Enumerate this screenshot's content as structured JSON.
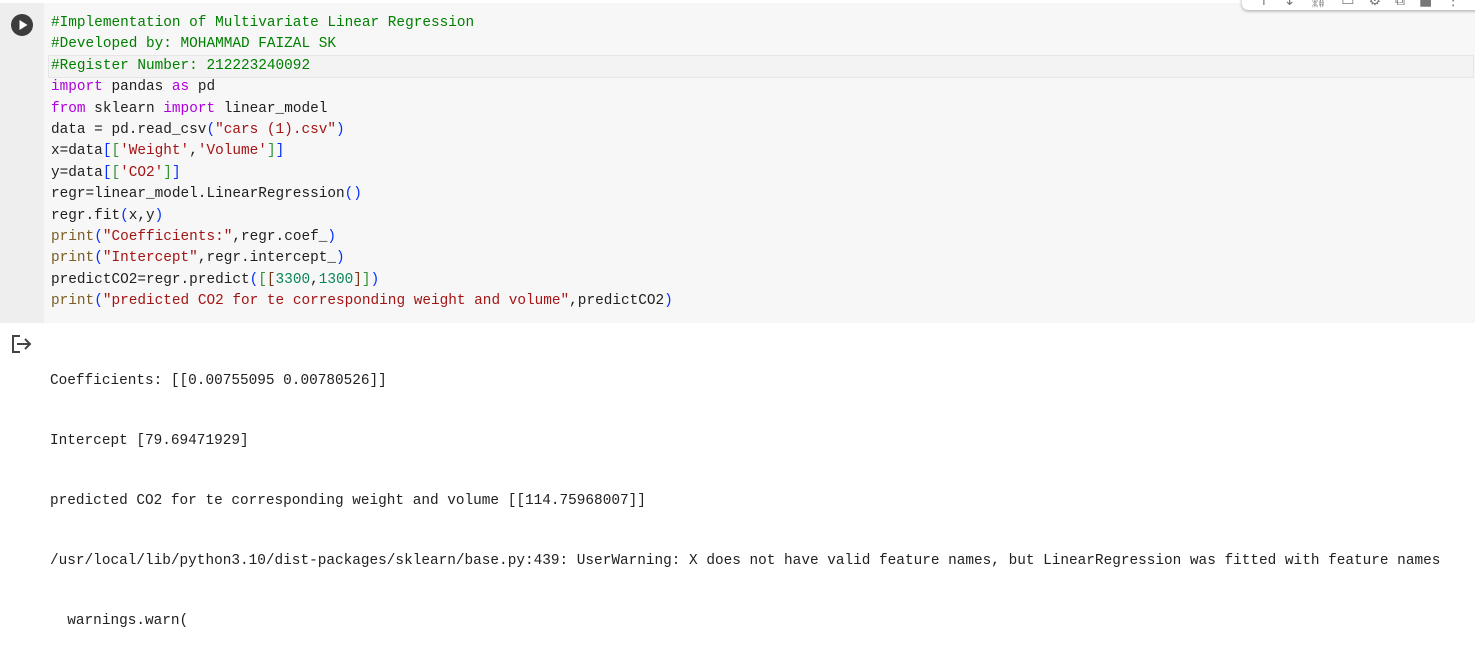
{
  "cell": {
    "run_icon": "play-circle-icon",
    "code_lines": [
      [
        [
          "#Implementation of Multivariate Linear Regression",
          "comment"
        ]
      ],
      [
        [
          "#Developed by: MOHAMMAD FAIZAL SK",
          "comment"
        ]
      ],
      [
        [
          "#Register Number: 212223240092",
          "comment"
        ]
      ],
      [
        [
          "import",
          "kw"
        ],
        [
          " pandas ",
          ""
        ],
        [
          "as",
          "kw"
        ],
        [
          " pd",
          ""
        ]
      ],
      [
        [
          "from",
          "kw"
        ],
        [
          " sklearn ",
          ""
        ],
        [
          "import",
          "kw"
        ],
        [
          " linear_model",
          ""
        ]
      ],
      [
        [
          "data = pd.read_csv",
          ""
        ],
        [
          "(",
          "b1"
        ],
        [
          "\"cars (1).csv\"",
          "str"
        ],
        [
          ")",
          "b1"
        ]
      ],
      [
        [
          "x=data",
          ""
        ],
        [
          "[",
          "b1"
        ],
        [
          "[",
          "b2"
        ],
        [
          "'Weight'",
          "str"
        ],
        [
          ",",
          ""
        ],
        [
          "'Volume'",
          "str"
        ],
        [
          "]",
          "b2"
        ],
        [
          "]",
          "b1"
        ]
      ],
      [
        [
          "y=data",
          ""
        ],
        [
          "[",
          "b1"
        ],
        [
          "[",
          "b2"
        ],
        [
          "'CO2'",
          "str"
        ],
        [
          "]",
          "b2"
        ],
        [
          "]",
          "b1"
        ]
      ],
      [
        [
          "regr=linear_model.LinearRegression",
          ""
        ],
        [
          "()",
          "b1"
        ]
      ],
      [
        [
          "regr.fit",
          ""
        ],
        [
          "(",
          "b1"
        ],
        [
          "x,y",
          ""
        ],
        [
          ")",
          "b1"
        ]
      ],
      [
        [
          "print",
          "fn"
        ],
        [
          "(",
          "b1"
        ],
        [
          "\"Coefficients:\"",
          "str"
        ],
        [
          ",regr.coef_",
          ""
        ],
        [
          ")",
          "b1"
        ]
      ],
      [
        [
          "print",
          "fn"
        ],
        [
          "(",
          "b1"
        ],
        [
          "\"Intercept\"",
          "str"
        ],
        [
          ",regr.intercept_",
          ""
        ],
        [
          ")",
          "b1"
        ]
      ],
      [
        [
          "predictCO2=regr.predict",
          ""
        ],
        [
          "(",
          "b1"
        ],
        [
          "[",
          "b2"
        ],
        [
          "[",
          "b3"
        ],
        [
          "3300",
          "num"
        ],
        [
          ",",
          ""
        ],
        [
          "1300",
          "num"
        ],
        [
          "]",
          "b3"
        ],
        [
          "]",
          "b2"
        ],
        [
          ")",
          "b1"
        ]
      ],
      [
        [
          "print",
          "fn"
        ],
        [
          "(",
          "b1"
        ],
        [
          "\"predicted CO2 for te corresponding weight and volume\"",
          "str"
        ],
        [
          ",predictCO2",
          ""
        ],
        [
          ")",
          "b1"
        ]
      ]
    ],
    "current_line": 2
  },
  "colors": {
    "comment": "#008000",
    "keyword": "#af00db",
    "string": "#a31515",
    "number": "#098658",
    "function": "#795e26",
    "bracket1": "#0431fa",
    "bracket2": "#319331",
    "bracket3": "#7b3814"
  },
  "toolbar": {
    "icons": [
      "arrow-up-icon",
      "arrow-down-icon",
      "link-icon",
      "comment-icon",
      "gear-icon",
      "mirror-cell-icon",
      "delete-icon",
      "more-vert-icon"
    ]
  },
  "output": {
    "icon": "output-arrow-icon",
    "lines": [
      "Coefficients: [[0.00755095 0.00780526]]",
      "Intercept [79.69471929]",
      "predicted CO2 for te corresponding weight and volume [[114.75968007]]",
      "/usr/local/lib/python3.10/dist-packages/sklearn/base.py:439: UserWarning: X does not have valid feature names, but LinearRegression was fitted with feature names",
      "  warnings.warn("
    ]
  }
}
